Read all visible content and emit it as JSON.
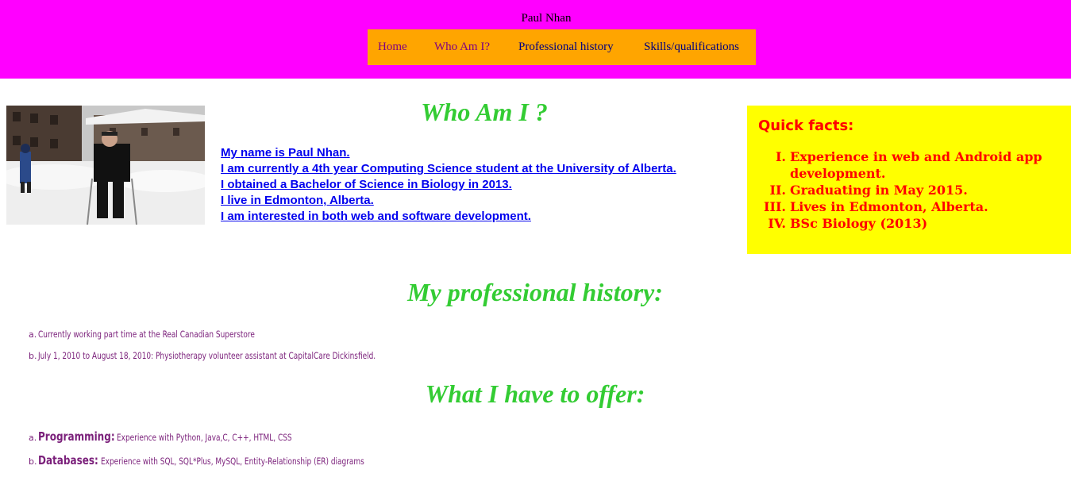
{
  "header": {
    "site_title": "Paul Nhan",
    "nav": [
      {
        "label": "Home"
      },
      {
        "label": "Who Am I?"
      },
      {
        "label": "Professional history"
      },
      {
        "label": "Skills/qualifications"
      }
    ]
  },
  "colors": {
    "header_bg": "#ff00ff",
    "nav_bg": "#ffa500",
    "heading": "#33cc33",
    "link": "#0000ee",
    "facts_bg": "#ffff00",
    "facts_text": "#ff0000",
    "list_text": "#7a1f7a"
  },
  "about": {
    "heading": "Who Am I ?",
    "lines": [
      "My name is Paul Nhan.",
      "I am currently a 4th year Computing Science student at the University of Alberta.",
      "I obtained a Bachelor of Science in Biology in 2013.",
      "I live in Edmonton, Alberta.",
      "I am interested in both web and software development."
    ]
  },
  "quick_facts": {
    "title": "Quick facts:",
    "items": [
      {
        "num": "I.",
        "text": "Experience in web and Android app development."
      },
      {
        "num": "II.",
        "text": "Graduating in May 2015."
      },
      {
        "num": "III.",
        "text": "Lives in Edmonton, Alberta."
      },
      {
        "num": "IV.",
        "text": "BSc Biology (2013)"
      }
    ]
  },
  "history": {
    "heading": "My professional history:",
    "items": [
      {
        "marker": "a.",
        "text": "Currently working part time at the Real Canadian Superstore"
      },
      {
        "marker": "b.",
        "text": "July 1, 2010 to August 18, 2010: Physiotherapy volunteer assistant at CapitalCare Dickinsfield."
      }
    ]
  },
  "offer": {
    "heading": "What I have to offer:",
    "items": [
      {
        "marker": "a.",
        "key": "Programming:",
        "text": "Experience with Python, Java,C, C++, HTML, CSS"
      },
      {
        "marker": "b.",
        "key": "Databases:",
        "text": "Experience with SQL, SQL*Plus, MySQL, Entity-Relationship (ER) diagrams"
      }
    ]
  }
}
